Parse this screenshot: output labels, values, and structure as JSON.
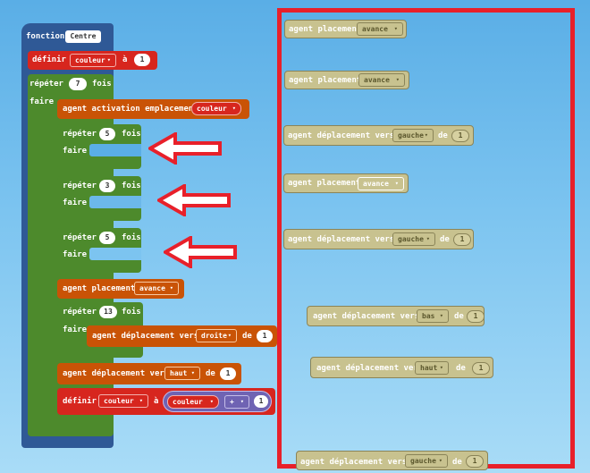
{
  "function_block": {
    "label": "fonction",
    "name": "Centre",
    "set_label": "définir",
    "set_var": "couleur",
    "set_to": "à",
    "set_value": "1",
    "repeat_label": "répéter",
    "repeat_count": "7",
    "times_label": "fois",
    "do_label": "faire",
    "activate_label": "agent activation emplacement",
    "activate_var": "couleur",
    "inner_repeats": [
      {
        "repeat": "répéter",
        "count": "5",
        "times": "fois",
        "do": "faire"
      },
      {
        "repeat": "répéter",
        "count": "3",
        "times": "fois",
        "do": "faire"
      },
      {
        "repeat": "répéter",
        "count": "5",
        "times": "fois",
        "do": "faire"
      }
    ],
    "place_label": "agent placement",
    "place_value": "avance",
    "repeat13_label": "répéter",
    "repeat13_count": "13",
    "repeat13_times": "fois",
    "repeat13_do": "faire",
    "move_right_label": "agent déplacement vers",
    "move_right_dir": "droite",
    "move_right_of": "de",
    "move_right_val": "1",
    "move_up_label": "agent déplacement vers",
    "move_up_dir": "haut",
    "move_up_of": "de",
    "move_up_val": "1",
    "final_set_label": "définir",
    "final_set_var": "couleur",
    "final_set_to": "à",
    "final_expr_var": "couleur",
    "final_expr_op": "+",
    "final_expr_val": "1"
  },
  "palette_blocks": [
    {
      "label": "agent placement",
      "value": "avance"
    },
    {
      "label": "agent placement",
      "value": "avance"
    },
    {
      "label": "agent déplacement vers",
      "value": "gauche",
      "of": "de",
      "num": "1"
    },
    {
      "label": "agent placement",
      "value": "avance"
    },
    {
      "label": "agent déplacement vers",
      "value": "gauche",
      "of": "de",
      "num": "1"
    },
    {
      "label": "agent déplacement vers",
      "value": "bas",
      "of": "de",
      "num": "1"
    },
    {
      "label": "agent déplacement vers",
      "value": "haut",
      "of": "de",
      "num": "1"
    },
    {
      "label": "agent déplacement vers",
      "value": "gauche",
      "of": "de",
      "num": "1"
    }
  ],
  "colors": {
    "function": "#2f5996",
    "loop": "#4d8a2c",
    "variable": "#d7261e",
    "agent": "#c95306",
    "ghost": "#c8c28f",
    "highlight_frame": "#e8202a",
    "arrow": "#e8202a"
  }
}
